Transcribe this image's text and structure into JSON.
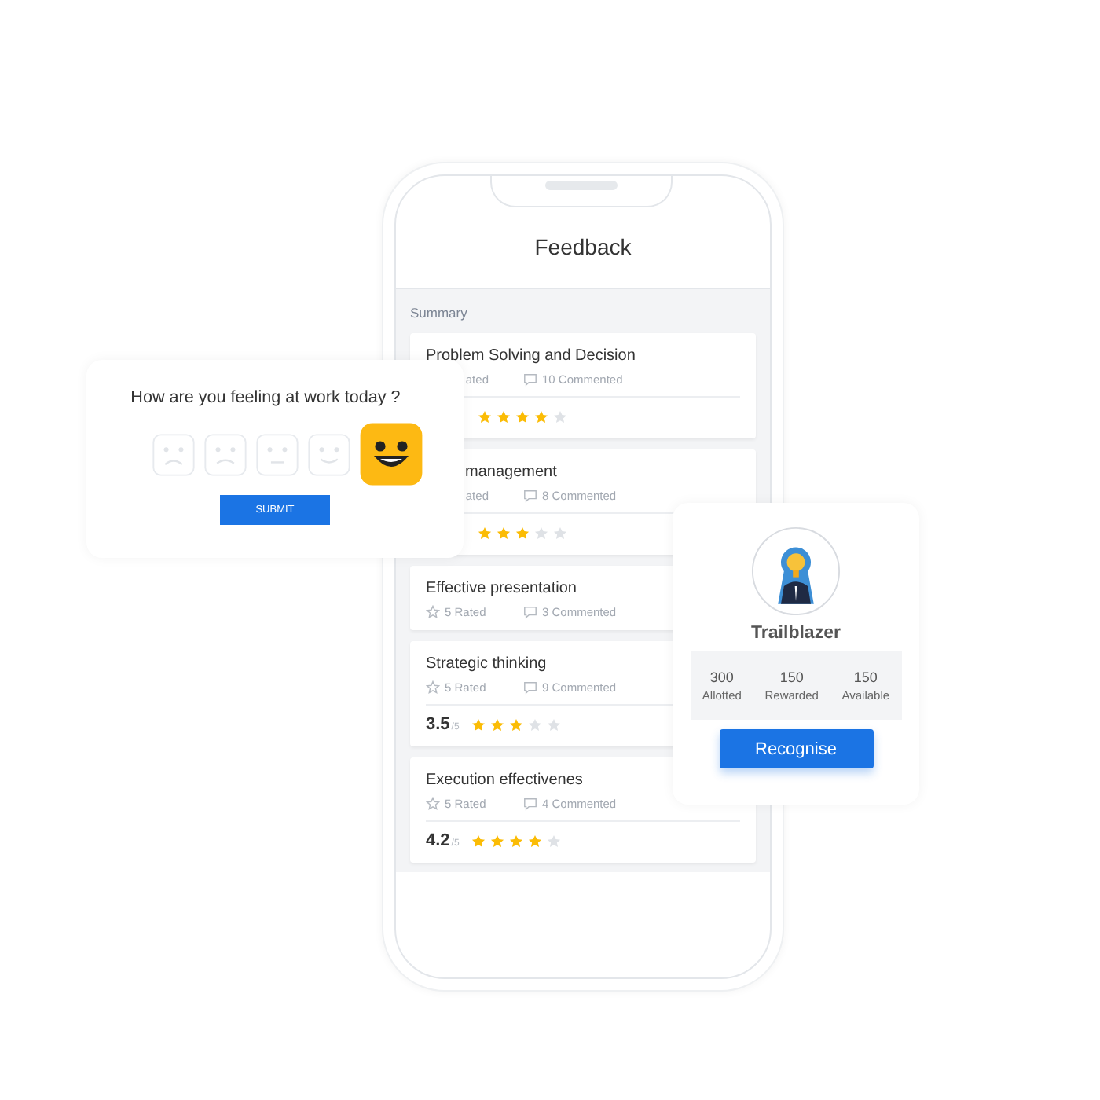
{
  "phone": {
    "title": "Feedback",
    "section": "Summary",
    "cards": [
      {
        "title": "Problem Solving and Decision",
        "rated": "ated",
        "commented": "10 Commented",
        "stars": 4,
        "title_covered": false,
        "lower_covered": true
      },
      {
        "title": "management",
        "rated": "ated",
        "commented": "8 Commented",
        "stars": 3,
        "title_covered": true,
        "lower_covered": true
      },
      {
        "title": "Effective presentation",
        "rated": "5 Rated",
        "commented": "3 Commented",
        "title_covered": false,
        "lower_covered": false
      },
      {
        "title": "Strategic thinking",
        "rated": "5 Rated",
        "commented": "9 Commented",
        "score": "3.5",
        "out_of": "/5",
        "stars": 3,
        "title_covered": false,
        "lower_covered": false
      },
      {
        "title": "Execution effectivenes",
        "rated": "5 Rated",
        "commented": "4 Commented",
        "score": "4.2",
        "out_of": "/5",
        "stars": 4,
        "title_covered": false,
        "lower_covered": false
      }
    ]
  },
  "mood_card": {
    "question": "How are you feeling at work today ?",
    "moods": [
      {
        "kind": "worried",
        "selected": false
      },
      {
        "kind": "sad",
        "selected": false
      },
      {
        "kind": "neutral",
        "selected": false
      },
      {
        "kind": "smile",
        "selected": false
      },
      {
        "kind": "grin",
        "selected": true
      }
    ],
    "button": "SUBMIT"
  },
  "badge_card": {
    "name": "Trailblazer",
    "stats": [
      {
        "value": "300",
        "label": "Allotted"
      },
      {
        "value": "150",
        "label": "Rewarded"
      },
      {
        "value": "150",
        "label": "Available"
      }
    ],
    "button": "Recognise"
  }
}
